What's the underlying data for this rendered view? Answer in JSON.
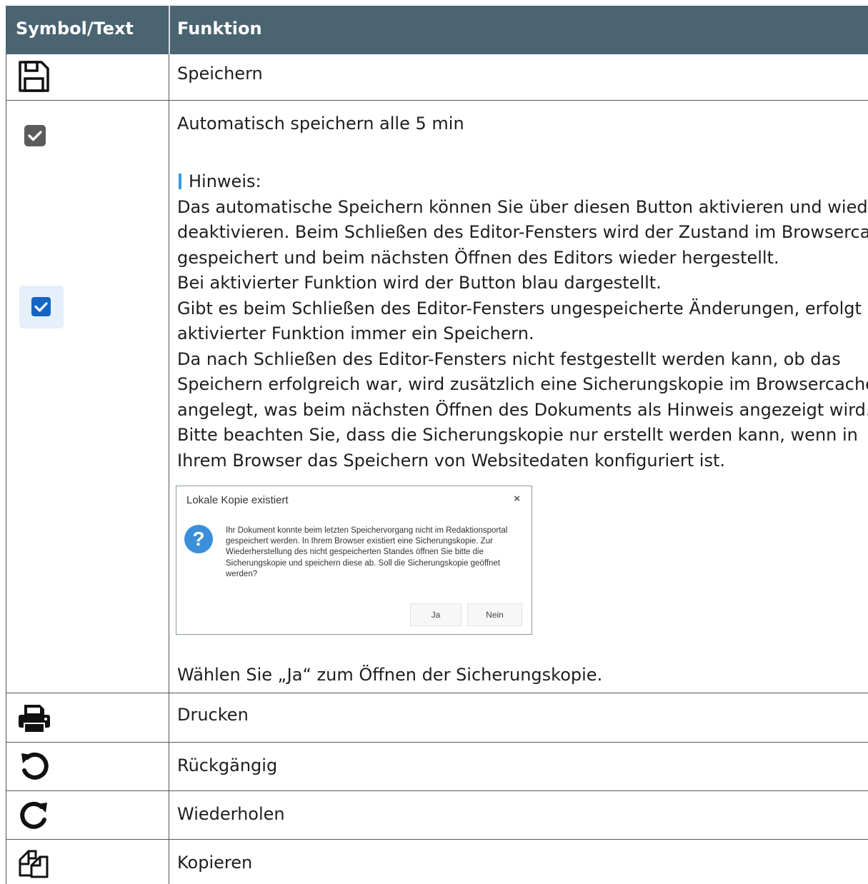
{
  "header": {
    "col1": "Symbol/Text",
    "col2": "Funktion"
  },
  "rows": {
    "save": {
      "icon": "floppy-disk-icon",
      "label": "Speichern"
    },
    "autosave": {
      "icons": [
        "checkbox-gray-checked-icon",
        "checkbox-blue-checked-icon"
      ],
      "label": "Automatisch speichern alle 5 min",
      "note_title": "Hinweis:",
      "paragraph": [
        "Das automatische Speichern können Sie über diesen Button aktivieren und wieder",
        "deaktivieren. Beim Schließen des Editor-Fensters wird der Zustand im Browsercache",
        "gespeichert und beim nächsten Öffnen des Editors wieder hergestellt.",
        "Bei aktivierter Funktion wird der Button blau dargestellt.",
        "Gibt es beim Schließen des Editor-Fensters ungespeicherte Änderungen, erfolgt bei",
        "aktivierter Funktion immer ein Speichern.",
        "Da nach Schließen des Editor-Fensters nicht festgestellt werden kann, ob das",
        "Speichern erfolgreich war, wird zusätzlich eine Sicherungskopie im Browsercache",
        "angelegt, was beim nächsten Öffnen des Dokuments als Hinweis angezeigt wird.",
        "Bitte beachten Sie, dass die Sicherungskopie nur erstellt werden kann, wenn in",
        "Ihrem Browser das Speichern von Websitedaten konfiguriert ist."
      ],
      "dialog": {
        "title": "Lokale Kopie existiert",
        "close": "×",
        "message": "Ihr Dokument konnte beim letzten Speichervorgang nicht im Redaktionsportal gespeichert werden. In Ihrem Browser existiert eine Sicherungskopie. Zur Wiederherstellung des nicht gespeicherten Standes öffnen Sie bitte die Sicherungskopie und speichern diese ab. Soll die Sicherungskopie geöffnet werden?",
        "yes": "Ja",
        "no": "Nein"
      },
      "footer": "Wählen Sie „Ja“ zum Öffnen der Sicherungskopie."
    },
    "print": {
      "icon": "printer-icon",
      "label": "Drucken"
    },
    "undo": {
      "icon": "undo-icon",
      "label": "Rückgängig"
    },
    "redo": {
      "icon": "redo-icon",
      "label": "Wiederholen"
    },
    "copy": {
      "icon": "copy-icon",
      "label": "Kopieren"
    }
  },
  "colors": {
    "header_bg": "#4a6472",
    "accent_blue": "#2f9ee8",
    "checkbox_gray": "#555555",
    "checkbox_blue": "#1565c0"
  }
}
